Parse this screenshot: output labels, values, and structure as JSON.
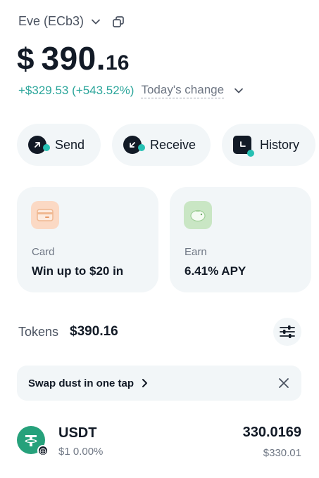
{
  "account": {
    "name": "Eve (ECb3)"
  },
  "balance": {
    "currency": "$",
    "integer": "390.",
    "decimal": "16"
  },
  "change": {
    "amount": "+$329.53 (+543.52%)",
    "label": "Today's change"
  },
  "actions": [
    {
      "label": "Send",
      "icon": "arrow-up-right-icon"
    },
    {
      "label": "Receive",
      "icon": "arrow-down-left-icon"
    },
    {
      "label": "History",
      "icon": "history-icon"
    }
  ],
  "cards": [
    {
      "label": "Card",
      "value": "Win up to $20 in",
      "icon": "card-icon",
      "icon_bg": "#fbd9c4"
    },
    {
      "label": "Earn",
      "value": "6.41%  APY",
      "icon": "piggy-bank-icon",
      "icon_bg": "#c9e6c4"
    }
  ],
  "tokens": {
    "label": "Tokens",
    "total": "$390.16"
  },
  "banner": {
    "text": "Swap dust in one tap"
  },
  "token_list": [
    {
      "symbol": "USDT",
      "price": "$1",
      "change": "0.00%",
      "amount": "330.0169",
      "fiat": "$330.01",
      "icon": "tether-icon"
    }
  ],
  "colors": {
    "accent": "#26c0b3",
    "positive": "#2aa59a",
    "surface": "#f2f6f8",
    "text": "#121a26"
  }
}
